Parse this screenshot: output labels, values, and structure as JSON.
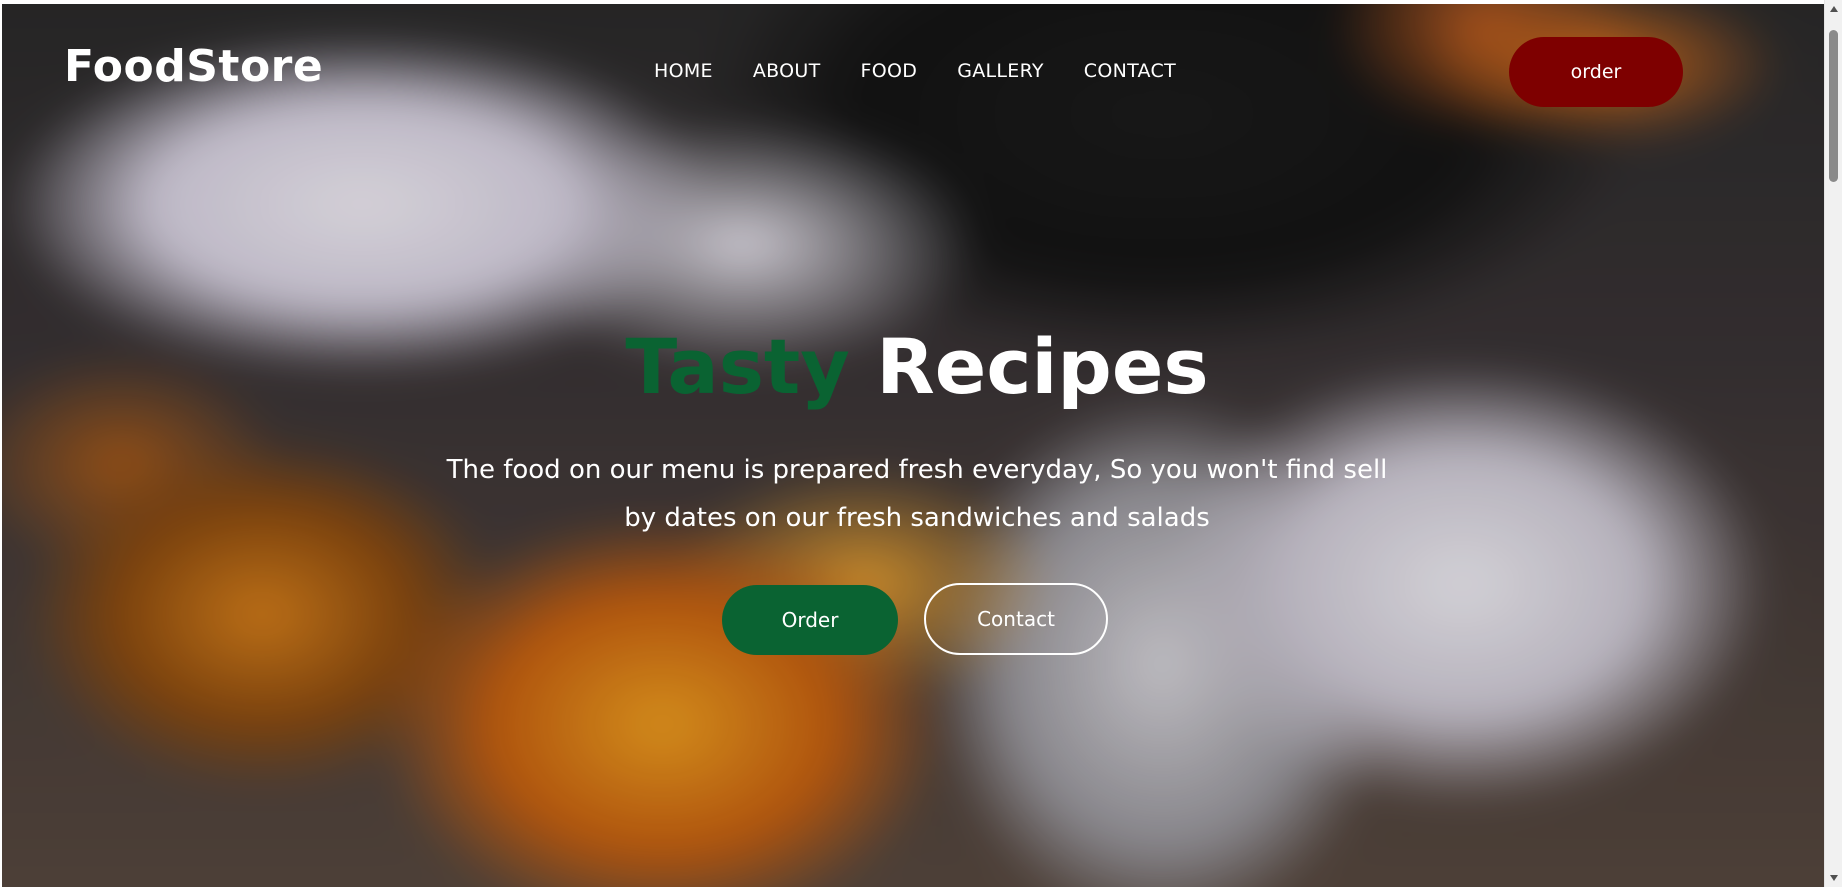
{
  "brand": {
    "name": "FoodStore"
  },
  "nav": {
    "items": [
      {
        "label": "HOME"
      },
      {
        "label": "ABOUT"
      },
      {
        "label": "FOOD"
      },
      {
        "label": "GALLERY"
      },
      {
        "label": "CONTACT"
      }
    ],
    "order_label": "order"
  },
  "hero": {
    "headline_accent": "Tasty",
    "headline_rest": "Recipes",
    "subtitle_line1": "The food on our menu is prepared fresh everyday, So you won't find sell",
    "subtitle_line2": "by dates on our fresh sandwiches and salads",
    "primary_button": "Order",
    "secondary_button": "Contact"
  },
  "colors": {
    "accent_green": "#0a6332",
    "order_red": "#7e0000",
    "text_white": "#ffffff"
  }
}
